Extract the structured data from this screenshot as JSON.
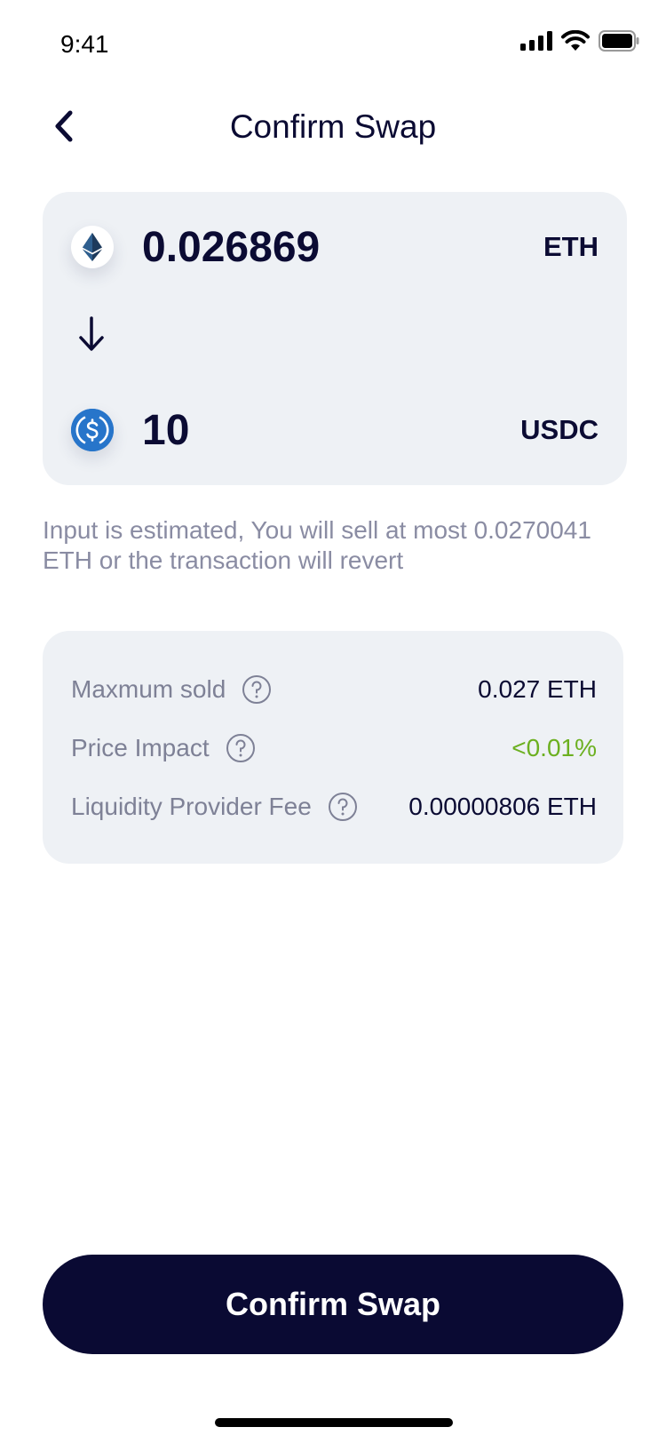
{
  "status_bar": {
    "time": "9:41",
    "icons": [
      "cellular-signal-icon",
      "wifi-icon",
      "battery-icon"
    ]
  },
  "header": {
    "back_icon": "chevron-left-icon",
    "title": "Confirm Swap"
  },
  "swap": {
    "from": {
      "icon": "ethereum-icon",
      "amount": "0.026869",
      "symbol": "ETH"
    },
    "direction_icon": "arrow-down-icon",
    "to": {
      "icon": "usdc-icon",
      "amount": "10",
      "symbol": "USDC"
    }
  },
  "note": "Input is estimated, You will sell at most  0.0270041 ETH or the transaction will revert",
  "details": [
    {
      "label": "Maxmum sold",
      "value": "0.027 ETH"
    },
    {
      "label": "Price Impact",
      "value": "<0.01%"
    },
    {
      "label": "Liquidity Provider Fee",
      "value": "0.00000806 ETH"
    }
  ],
  "confirm_button": {
    "label": "Confirm Swap"
  },
  "colors": {
    "primary": "#0a0a33",
    "card_background": "#eef1f5",
    "muted_text": "#8a8ca3",
    "positive": "#6cb020",
    "usdc_blue": "#2775ca"
  }
}
